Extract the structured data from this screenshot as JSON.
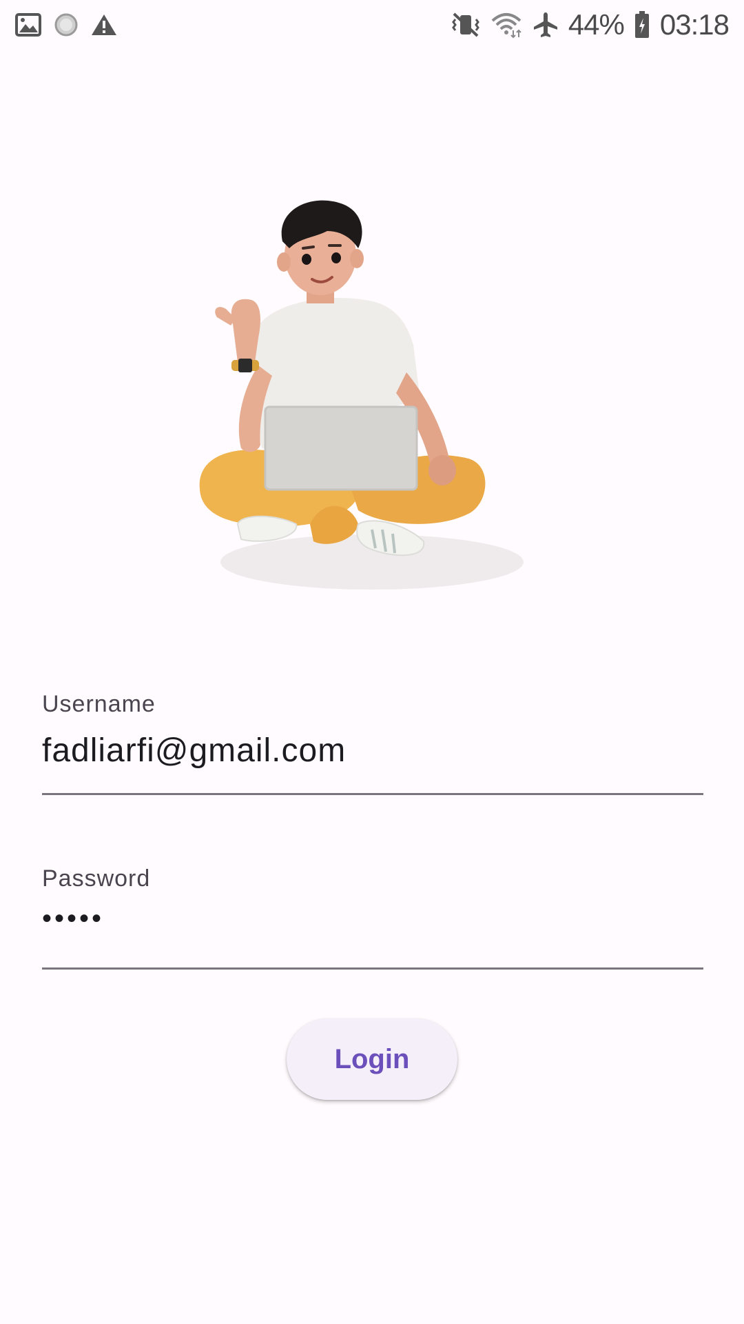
{
  "status_bar": {
    "left_icons": [
      "image-icon",
      "loading-icon",
      "warning-icon"
    ],
    "right_icons": [
      "vibrate-mute-icon",
      "wifi-icon",
      "airplane-icon",
      "battery-icon"
    ],
    "battery_text": "44%",
    "time": "03:18"
  },
  "illustration": {
    "icon": "person-with-laptop-illustration"
  },
  "form": {
    "username": {
      "label": "Username",
      "value": "fadliarfi@gmail.com"
    },
    "password": {
      "label": "Password",
      "value": "•••••"
    },
    "login_label": "Login"
  },
  "colors": {
    "background": "#fffbfe",
    "accent": "#6b4fbb",
    "button_bg": "#f4eff8",
    "underline": "#79747e"
  }
}
